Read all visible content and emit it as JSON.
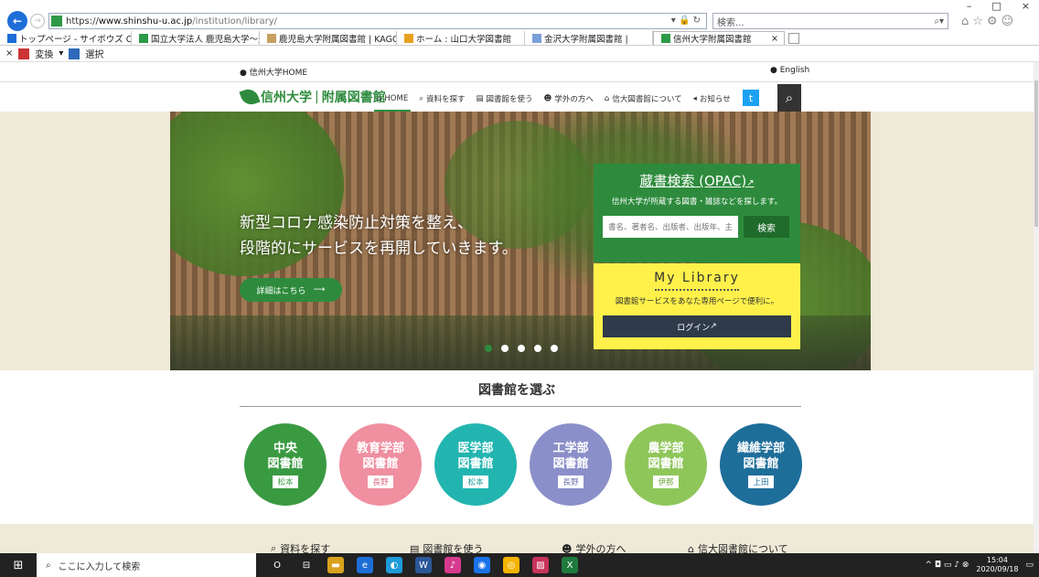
{
  "browser": {
    "window_controls": [
      "–",
      "□",
      "×"
    ],
    "url": {
      "https": "https://",
      "host": "www.shinshu-u.ac.jp",
      "path": "/institution/library/"
    },
    "url_icons": "▾ 🔒 ↻",
    "search_placeholder": "検索...",
    "search_icon": "⌕▾",
    "right_icons": "⌂☆⚙☺",
    "tabs": [
      {
        "label": "トップページ - サイボウズ Office",
        "color": "#1e6ed8"
      },
      {
        "label": "国立大学法人 鹿児島大学〜進...",
        "color": "#2e9a48"
      },
      {
        "label": "鹿児島大学附属図書館 | KAGO...",
        "color": "#c8a060"
      },
      {
        "label": "ホーム : 山口大学図書館",
        "color": "#e6a21e"
      },
      {
        "label": "金沢大学附属図書館 |",
        "color": "#7aa0d8"
      },
      {
        "label": "信州大学附属図書館",
        "color": "#2e9a48"
      }
    ],
    "tab_close": "×",
    "cmd": {
      "close": "×",
      "convert": "変換",
      "select": "選択",
      "arrow": "▾"
    }
  },
  "site": {
    "home_link": "信州大学HOME",
    "english_link": "English",
    "logo_main": "信州大学",
    "logo_sub": "附属図書館",
    "nav": [
      {
        "icon": "⌂",
        "label": "HOME"
      },
      {
        "icon": "⌕",
        "label": "資料を探す"
      },
      {
        "icon": "▤",
        "label": "図書館を使う"
      },
      {
        "icon": "☻",
        "label": "学外の方へ"
      },
      {
        "icon": "⌂",
        "label": "信大図書館について"
      },
      {
        "icon": "◂",
        "label": "お知らせ"
      }
    ],
    "twitter_icon": "t",
    "search_icon": "⌕"
  },
  "hero": {
    "message_line1": "新型コロナ感染防止対策を整え、",
    "message_line2": "段階的にサービスを再開していきます。",
    "detail_button": "詳細はこちら",
    "detail_arrow": "⟶",
    "slide_count": 5,
    "active_slide": 0
  },
  "opac": {
    "title": "蔵書検索 (OPAC)",
    "title_icon": "↗",
    "description": "信州大学が所蔵する図書・雑誌などを探します。",
    "input_placeholder": "書名、著者名、出版者、出版年、主",
    "search_button": "検索"
  },
  "mylibrary": {
    "title": "My Library",
    "description": "図書館サービスをあなた専用ページで便利に。",
    "login_button": "ログイン",
    "login_icon": "↗"
  },
  "library_select": {
    "title": "図書館を選ぶ",
    "libraries": [
      {
        "line1": "中央",
        "line2": "図書館",
        "location": "松本",
        "color": "#3a9a42",
        "loc_color": "#3a9a42"
      },
      {
        "line1": "教育学部",
        "line2": "図書館",
        "location": "長野",
        "color": "#ef8fa0",
        "loc_color": "#e06a80"
      },
      {
        "line1": "医学部",
        "line2": "図書館",
        "location": "松本",
        "color": "#22b5b0",
        "loc_color": "#1a9b96"
      },
      {
        "line1": "工学部",
        "line2": "図書館",
        "location": "長野",
        "color": "#8a8fc9",
        "loc_color": "#6e73b2"
      },
      {
        "line1": "農学部",
        "line2": "図書館",
        "location": "伊那",
        "color": "#8fc65a",
        "loc_color": "#6ea83c"
      },
      {
        "line1": "繊維学部",
        "line2": "図書館",
        "location": "上田",
        "color": "#1e6e9a",
        "loc_color": "#1e6e9a"
      }
    ]
  },
  "bottom_links": [
    {
      "icon": "⌕",
      "label": "資料を探す"
    },
    {
      "icon": "▤",
      "label": "図書館を使う"
    },
    {
      "icon": "☻",
      "label": "学外の方へ"
    },
    {
      "icon": "⌂",
      "label": "信大図書館について"
    }
  ],
  "taskbar": {
    "start_icon": "⊞",
    "search_placeholder": "ここに入力して検索",
    "search_icon": "⌕",
    "apps": [
      {
        "glyph": "O",
        "color": "#222"
      },
      {
        "glyph": "⊟",
        "color": "#222"
      },
      {
        "glyph": "▬",
        "color": "#d9a21e"
      },
      {
        "glyph": "e",
        "color": "#1e6ed8"
      },
      {
        "glyph": "◐",
        "color": "#1e9bd8"
      },
      {
        "glyph": "W",
        "color": "#2b5797"
      },
      {
        "glyph": "♪",
        "color": "#d63a8f"
      },
      {
        "glyph": "◉",
        "color": "#1a73e8"
      },
      {
        "glyph": "◎",
        "color": "#f4b400"
      },
      {
        "glyph": "▨",
        "color": "#c8325a"
      },
      {
        "glyph": "X",
        "color": "#1f7a3e"
      }
    ],
    "tray_icons": "^ ◘ ▭ ♪ ⊗",
    "time": "15:04",
    "date": "2020/09/18",
    "notification_icon": "▭"
  }
}
